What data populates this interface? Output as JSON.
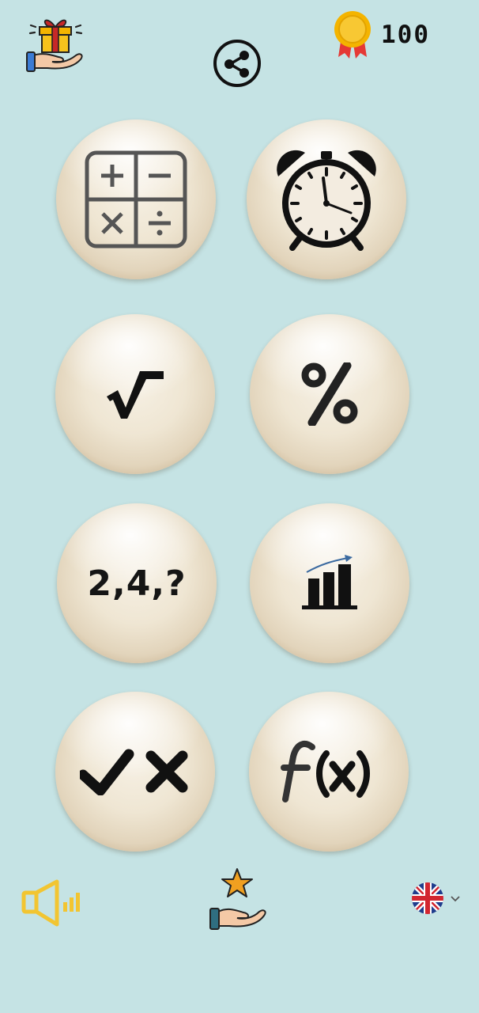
{
  "header": {
    "gift_icon": "gift-in-hand-icon",
    "share_icon": "share-icon",
    "coins": {
      "icon": "gold-medal-icon",
      "count": "100"
    }
  },
  "categories": [
    {
      "id": "arithmetic",
      "icon": "calculator-operations-icon"
    },
    {
      "id": "time",
      "icon": "alarm-clock-icon"
    },
    {
      "id": "square-root",
      "icon": "square-root-icon"
    },
    {
      "id": "percentage",
      "icon": "percent-icon"
    },
    {
      "id": "sequence",
      "label": "2,4,?"
    },
    {
      "id": "statistics",
      "icon": "bar-chart-icon"
    },
    {
      "id": "true-false",
      "icon": "check-cross-icon"
    },
    {
      "id": "function",
      "icon": "function-fx-icon"
    }
  ],
  "footer": {
    "sound_icon": "speaker-icon",
    "rate_icon": "star-in-hand-icon",
    "language_icon": "uk-flag-icon",
    "dropdown_icon": "chevron-down-icon"
  },
  "colors": {
    "background": "#c5e3e4",
    "ball": "#efe6d3",
    "speaker": "#f2c531",
    "gift_box": "#f4b400",
    "gift_ribbon": "#c62828",
    "coin": "#f4b400",
    "coin_ribbon": "#e53935"
  }
}
